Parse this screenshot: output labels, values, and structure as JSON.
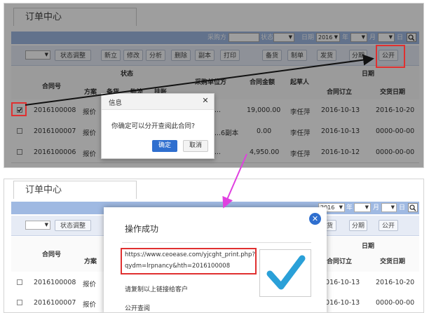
{
  "page_title": "订单中心",
  "filter_bar": {
    "buyer_label": "采购方",
    "status_label": "状态",
    "date_label": "日期",
    "year_value": "2016",
    "year_unit": "年",
    "month_unit": "月",
    "day_unit": "日",
    "search_icon": "magnifier"
  },
  "toolbar": {
    "status_adjust": "状态调整",
    "new": "新立",
    "edit": "修改",
    "analyze": "分析",
    "delete": "删除",
    "copy": "副本",
    "print": "打印",
    "stock": "备货",
    "make": "制单",
    "ship": "发货",
    "installment": "分期",
    "public": "公开"
  },
  "table": {
    "headers": {
      "contract_no": "合同号",
      "status": "状态",
      "plan": "方案",
      "stock": "备货",
      "send": "物流",
      "link": "挂账",
      "party": "采购单位方",
      "amount": "合同金额",
      "creator": "起草人",
      "date": "日期",
      "sign_date": "合同订立",
      "deliver_date": "交货日期"
    },
    "rows": [
      {
        "no": "2016100008",
        "plan": "报价",
        "party": "...",
        "amount": "19,000.00",
        "creator": "李任萍",
        "sign": "2016-10-13",
        "deliver": "2016-10-20"
      },
      {
        "no": "2016100007",
        "plan": "报价",
        "party": "...6副本",
        "amount": "0.00",
        "creator": "李任萍",
        "sign": "2016-10-13",
        "deliver": "0000-00-00"
      },
      {
        "no": "2016100006",
        "plan": "报价",
        "party": "...",
        "amount": "4,950.00",
        "creator": "李任萍",
        "sign": "2016-10-12",
        "deliver": "0000-00-00"
      }
    ],
    "rows_bottom": [
      {
        "no": "2016100008",
        "plan": "报价",
        "sign": "2016-10-13",
        "deliver": "2016-10-20"
      },
      {
        "no": "2016100007",
        "plan": "报价",
        "sign": "2016-10-13",
        "deliver": "0000-00-00"
      }
    ]
  },
  "confirm_dialog": {
    "title": "信息",
    "message": "你确定可以分开查阅此合同?",
    "ok": "确定",
    "cancel": "取消"
  },
  "success_dialog": {
    "title": "操作成功",
    "url_line1": "https://www.ceoease.com/yjcght_print.php?",
    "url_line2": "qydm=lrpnancy&hth=2016100008",
    "hint": "请复制以上链接给客户",
    "public_link": "公开查阅"
  },
  "colors": {
    "accent_blue": "#2f6fcf",
    "annotation_red": "#e03030",
    "annotation_magenta": "#e040e0",
    "check_blue": "#2aa0d8"
  }
}
